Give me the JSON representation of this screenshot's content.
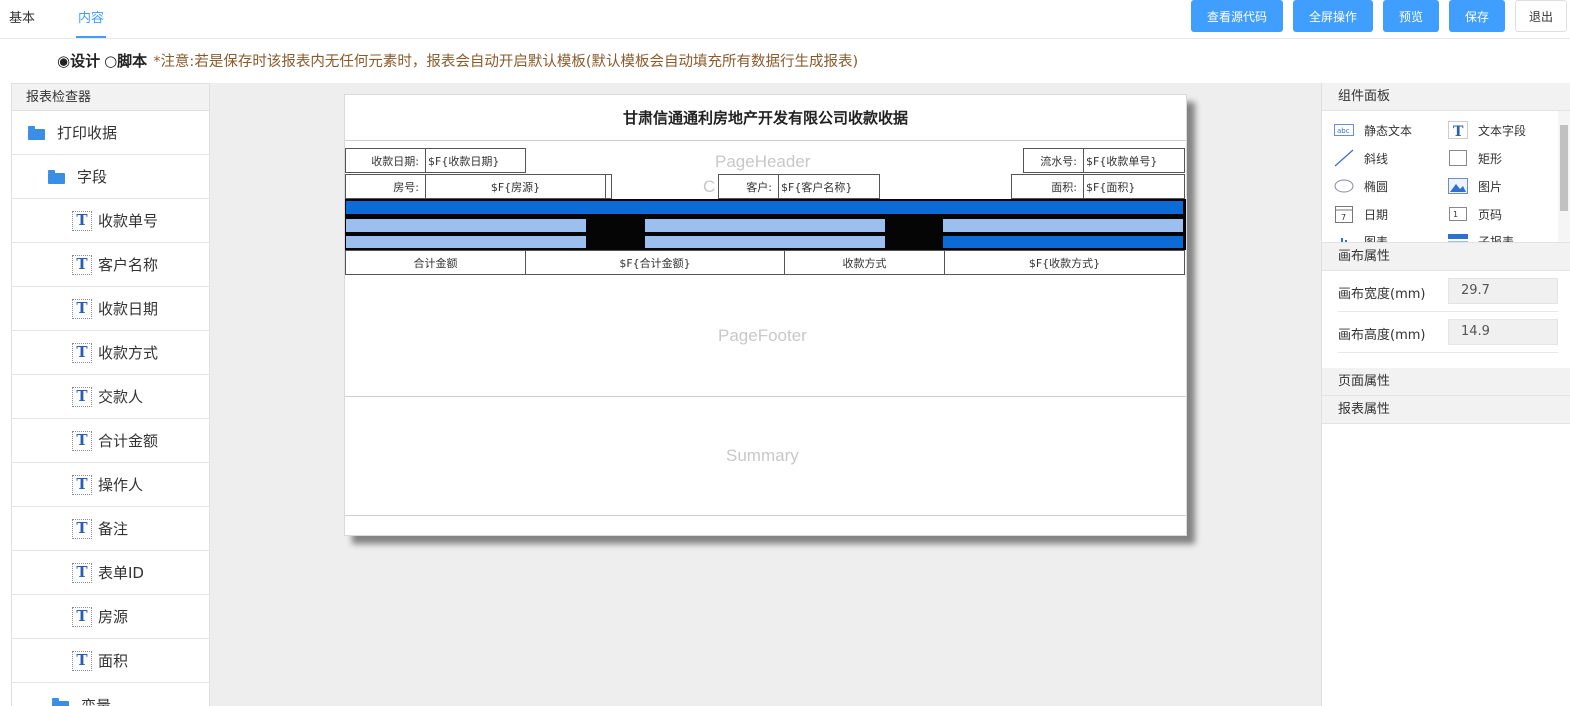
{
  "tabs": [
    {
      "label": "基本"
    },
    {
      "label": "内容"
    }
  ],
  "toolbar": {
    "view_source": "查看源代码",
    "fullscreen": "全屏操作",
    "preview": "预览",
    "save": "保存",
    "exit": "退出"
  },
  "mode": {
    "design": "◉设计",
    "script": "○脚本",
    "note": "*注意:若是保存时该报表内无任何元素时，报表会自动开启默认模板(默认模板会自动填充所有数据行生成报表)"
  },
  "inspector": {
    "title": "报表检查器",
    "root": "打印收据",
    "group": "字段",
    "fields": [
      "收款单号",
      "客户名称",
      "收款日期",
      "收款方式",
      "交款人",
      "合计金额",
      "操作人",
      "备注",
      "表单ID",
      "房源",
      "面积"
    ],
    "next_group": "变量"
  },
  "report": {
    "title": "甘肃信通通利房地产开发有限公司收款收据",
    "band_header": "PageHeader",
    "band_content_partial": "C",
    "band_footer": "PageFooter",
    "band_summary": "Summary",
    "row1": {
      "date_label": "收款日期:",
      "date_value": "$F{收款日期}",
      "serial_label": "流水号:",
      "serial_value": "$F{收款单号}"
    },
    "row2": {
      "room_label": "房号:",
      "room_value": "$F{房源}",
      "customer_label": "客户:",
      "customer_value": "$F{客户名称}",
      "area_label": "面积:",
      "area_value": "$F{面积}"
    },
    "row3": {
      "total_label": "合计金额",
      "total_value": "$F{合计金额}",
      "method_label": "收款方式",
      "method_value": "$F{收款方式}"
    }
  },
  "components": {
    "title": "组件面板",
    "items": [
      {
        "label": "静态文本",
        "icon": "static-text-icon"
      },
      {
        "label": "文本字段",
        "icon": "text-field-icon"
      },
      {
        "label": "斜线",
        "icon": "line-icon"
      },
      {
        "label": "矩形",
        "icon": "rectangle-icon"
      },
      {
        "label": "椭圆",
        "icon": "ellipse-icon"
      },
      {
        "label": "图片",
        "icon": "image-icon"
      },
      {
        "label": "日期",
        "icon": "date-icon"
      },
      {
        "label": "页码",
        "icon": "page-number-icon"
      },
      {
        "label": "图表",
        "icon": "chart-icon"
      },
      {
        "label": "子报表",
        "icon": "subreport-icon"
      }
    ]
  },
  "canvas_props": {
    "title": "画布属性",
    "width_label": "画布宽度(mm)",
    "width_value": "29.7",
    "height_label": "画布高度(mm)",
    "height_value": "14.9"
  },
  "page_props": {
    "title": "页面属性"
  },
  "report_props": {
    "title": "报表属性"
  },
  "colors": {
    "accent": "#409eff",
    "bar_dark": "#0d6bd8",
    "bar_light": "#9dbff0",
    "bar_black": "#050505"
  }
}
